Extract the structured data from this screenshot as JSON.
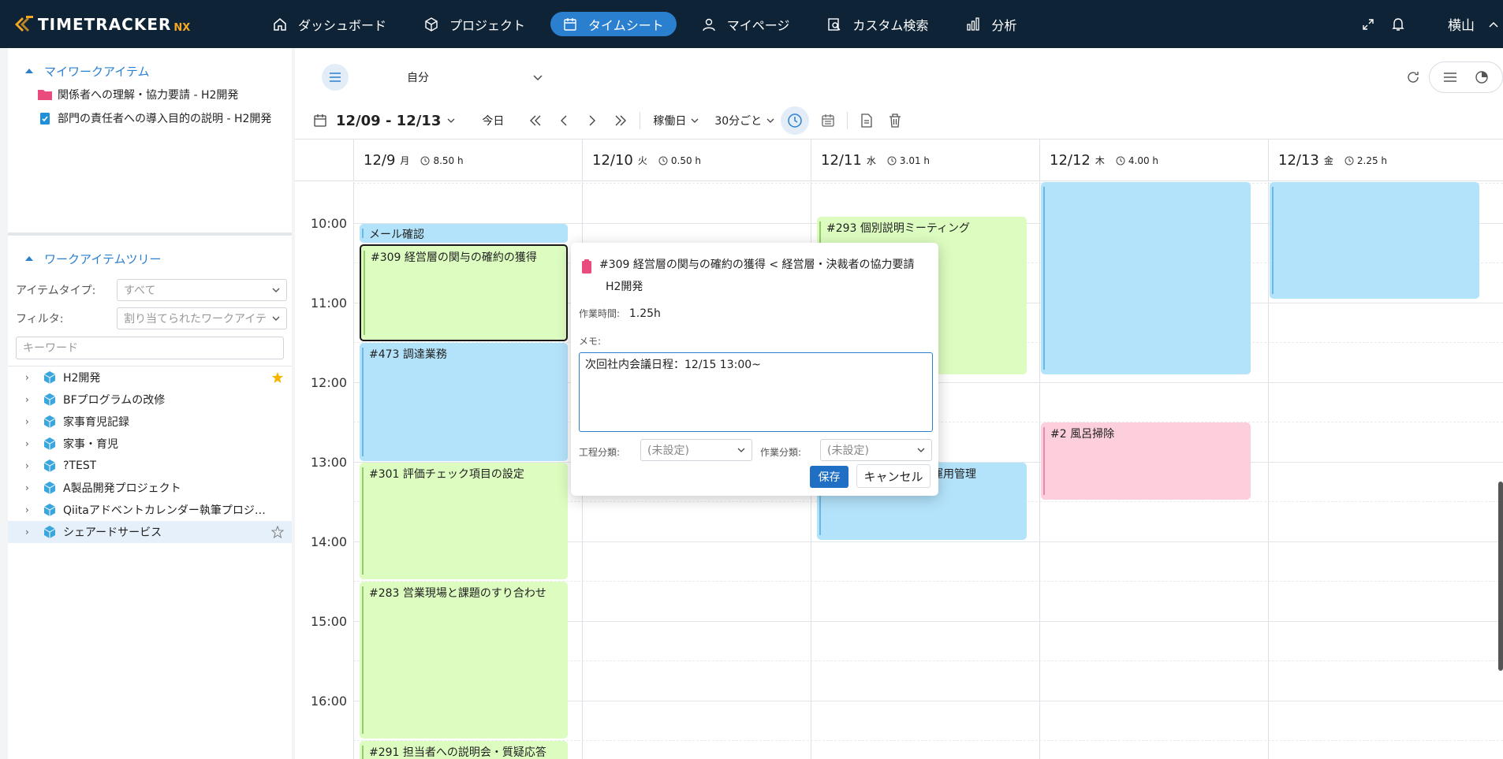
{
  "app": {
    "logo_text": "TIMETRACKER",
    "logo_suffix": "NX",
    "user_name": "横山"
  },
  "nav": {
    "items": [
      {
        "label": "ダッシュボード",
        "icon": "home-icon"
      },
      {
        "label": "プロジェクト",
        "icon": "cube-icon"
      },
      {
        "label": "タイムシート",
        "icon": "calendar-icon",
        "active": true
      },
      {
        "label": "マイページ",
        "icon": "user-icon"
      },
      {
        "label": "カスタム検索",
        "icon": "search-doc-icon"
      },
      {
        "label": "分析",
        "icon": "bar-chart-icon"
      }
    ]
  },
  "sidebar": {
    "my_work": {
      "title": "マイワークアイテム",
      "items": [
        {
          "label": "関係者への理解・協力要請 - H2開発",
          "icon": "folder-icon"
        },
        {
          "label": "部門の責任者への導入目的の説明 - H2開発",
          "icon": "task-icon"
        }
      ]
    },
    "tree": {
      "title": "ワークアイテムツリー",
      "item_type_label": "アイテムタイプ:",
      "item_type_value": "すべて",
      "filter_label": "フィルタ:",
      "filter_value": "割り当てられたワークアイテム",
      "keyword_placeholder": "キーワード",
      "items": [
        {
          "label": "H2開発",
          "starred": true
        },
        {
          "label": "BFプログラムの改修"
        },
        {
          "label": "家事育児記録"
        },
        {
          "label": "家事・育児"
        },
        {
          "label": "?TEST"
        },
        {
          "label": "A製品開発プロジェクト"
        },
        {
          "label": "Qiitaアドベントカレンダー執筆プロジェクト"
        },
        {
          "label": "シェアードサービス",
          "selected": true
        }
      ]
    }
  },
  "toolbar": {
    "user_select": "自分",
    "date_range": "12/09 - 12/13",
    "today": "今日",
    "day_mode": "稼働日",
    "interval": "30分ごと"
  },
  "calendar": {
    "days": [
      {
        "date": "12/9",
        "weekday": "月",
        "hours": "8.50 h"
      },
      {
        "date": "12/10",
        "weekday": "火",
        "hours": "0.50 h"
      },
      {
        "date": "12/11",
        "weekday": "水",
        "hours": "3.01 h"
      },
      {
        "date": "12/12",
        "weekday": "木",
        "hours": "4.00 h"
      },
      {
        "date": "12/13",
        "weekday": "金",
        "hours": "2.25 h"
      }
    ],
    "times": [
      "10:00",
      "11:00",
      "12:00",
      "13:00",
      "14:00",
      "15:00",
      "16:00"
    ],
    "events": [
      {
        "title": "メール確認",
        "color": "blue"
      },
      {
        "title": "#309 経営層の関与の確約の獲得",
        "color": "green",
        "selected": true
      },
      {
        "title": "#473 調達業務",
        "color": "blue"
      },
      {
        "title": "#301 評価チェック項目の設定",
        "color": "green"
      },
      {
        "title": "#283 営業現場と課題のすり合わせ",
        "color": "green"
      },
      {
        "title": "#291 担当者への説明会・質疑応答",
        "color": "green"
      },
      {
        "title": "#293 個別説明ミーティング",
        "color": "green"
      },
      {
        "title": "運用管理",
        "color": "blue"
      },
      {
        "title": "#2 風呂掃除",
        "color": "pink"
      },
      {
        "title": "",
        "color": "blue"
      },
      {
        "title": "",
        "color": "blue"
      }
    ]
  },
  "popup": {
    "title_line1": "#309  経営層の関与の確約の獲得  <  経営層・決裁者の協力要請",
    "title_line2": "H2開発",
    "duration_label": "作業時間:",
    "duration_value": "1.25h",
    "memo_label": "メモ:",
    "memo_value": "次回社内会議日程：12/15 13:00~",
    "process_label": "工程分類:",
    "process_value": "(未設定)",
    "work_label": "作業分類:",
    "work_value": "(未設定)",
    "save_label": "保存",
    "cancel_label": "キャンセル"
  },
  "colors": {
    "topbar": "#0f2336",
    "accent": "#2a7fcf",
    "event_green": "#dcfcc0",
    "event_blue": "#b3e3fb",
    "event_pink": "#fdcfdc"
  }
}
